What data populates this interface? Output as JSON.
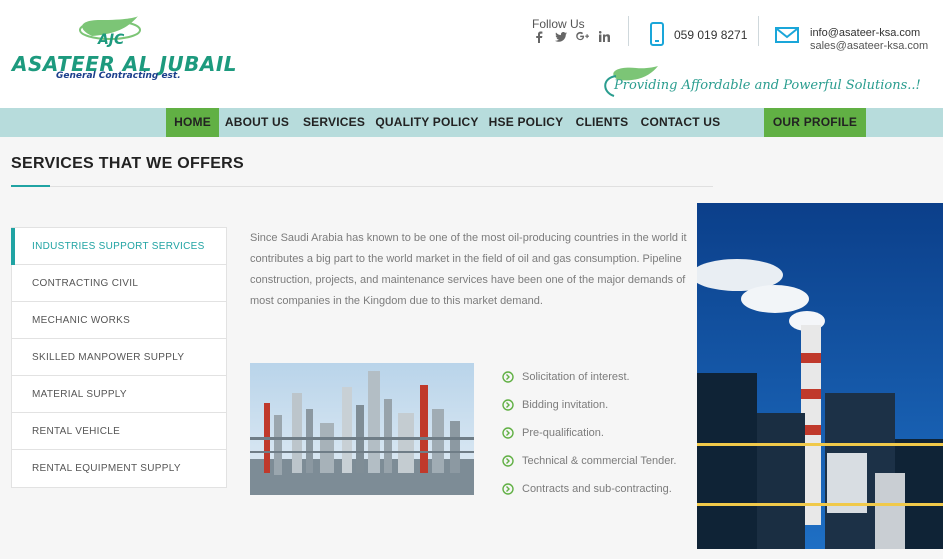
{
  "logo": {
    "initials": "AJC",
    "brand": "ASATEER AL JUBAIL",
    "sub": "General Contracting est."
  },
  "header": {
    "follow_label": "Follow Us",
    "socials": [
      "facebook-icon",
      "twitter-icon",
      "google-plus-icon",
      "linkedin-icon"
    ],
    "phone": "059 019 8271",
    "email1": "info@asateer-ksa.com",
    "email2": "sales@asateer-ksa.com",
    "tagline": "Providing Affordable and Powerful Solutions..!"
  },
  "nav": {
    "items": [
      "HOME",
      "ABOUT US",
      "SERVICES",
      "QUALITY POLICY",
      "HSE POLICY",
      "CLIENTS",
      "CONTACT US"
    ],
    "profile": "OUR PROFILE"
  },
  "page": {
    "title": "SERVICES THAT WE OFFERS"
  },
  "sidebar": {
    "items": [
      "INDUSTRIES SUPPORT SERVICES",
      "CONTRACTING CIVIL",
      "MECHANIC WORKS",
      "SKILLED MANPOWER SUPPLY",
      "MATERIAL SUPPLY",
      "RENTAL VEHICLE",
      "RENTAL EQUIPMENT SUPPLY"
    ]
  },
  "content": {
    "description": "Since Saudi Arabia has known to be one of the most oil-producing countries in the world it contributes a big part to the world market in the field of oil and gas consumption. Pipeline construction, projects, and maintenance services have been one of the major demands of most companies in the Kingdom due to this market demand.",
    "bullets": [
      "Solicitation of interest.",
      "Bidding invitation.",
      "Pre-qualification.",
      "Technical & commercial Tender.",
      "Contracts and sub-contracting."
    ]
  },
  "colors": {
    "accent": "#20a3a3",
    "nav_active": "#61b044",
    "nav_bar": "#b7dcdc",
    "icon_blue": "#1aa6d9"
  }
}
